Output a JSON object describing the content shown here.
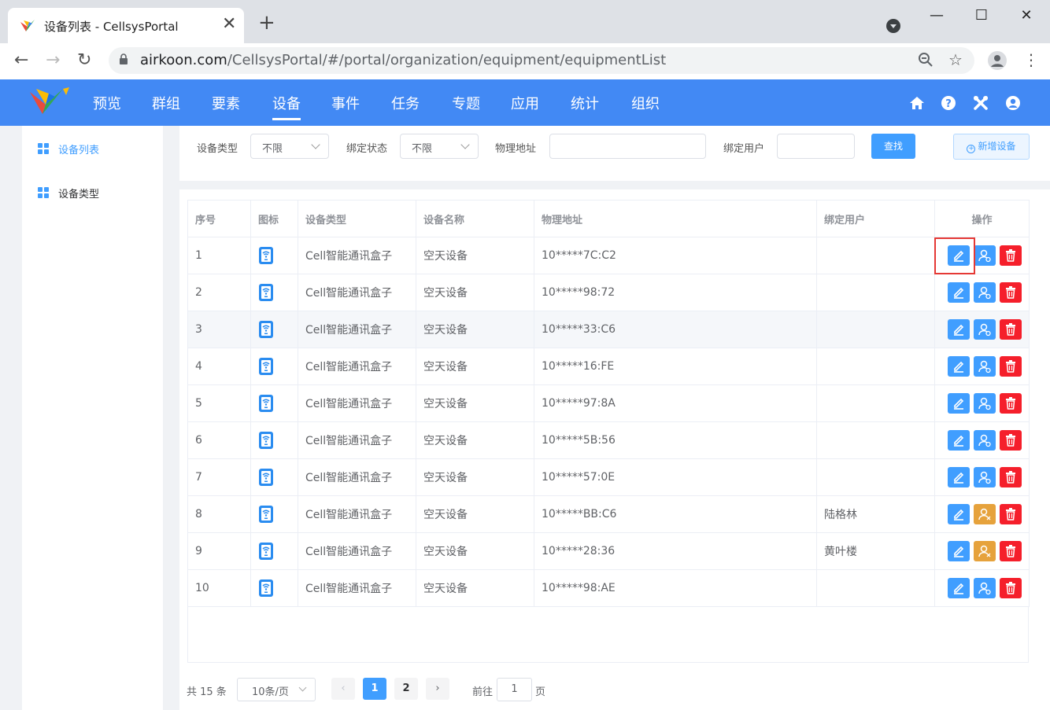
{
  "browser": {
    "tab_title": "设备列表 - CellsysPortal",
    "url_host": "airkoon.com",
    "url_path": "/CellsysPortal/#/portal/organization/equipment/equipmentList"
  },
  "app": {
    "menu": [
      "预览",
      "群组",
      "要素",
      "设备",
      "事件",
      "任务",
      "专题",
      "应用",
      "统计",
      "组织"
    ],
    "active_menu": "设备",
    "brand_color": "#4289f4"
  },
  "sidebar": {
    "items": [
      {
        "label": "设备列表",
        "active": true
      },
      {
        "label": "设备类型",
        "active": false
      }
    ]
  },
  "filters": {
    "type_label": "设备类型",
    "type_value": "不限",
    "bind_label": "绑定状态",
    "bind_value": "不限",
    "mac_label": "物理地址",
    "mac_value": "",
    "user_label": "绑定用户",
    "user_value": "",
    "search_label": "查找",
    "add_label": "新增设备"
  },
  "table": {
    "headers": [
      "序号",
      "图标",
      "设备类型",
      "设备名称",
      "物理地址",
      "绑定用户",
      "操作"
    ],
    "rows": [
      {
        "no": "1",
        "type": "Cell智能通讯盒子",
        "name": "空天设备",
        "mac": "10*****7C:C2",
        "user": "",
        "bound": false
      },
      {
        "no": "2",
        "type": "Cell智能通讯盒子",
        "name": "空天设备",
        "mac": "10*****98:72",
        "user": "",
        "bound": false
      },
      {
        "no": "3",
        "type": "Cell智能通讯盒子",
        "name": "空天设备",
        "mac": "10*****33:C6",
        "user": "",
        "bound": false
      },
      {
        "no": "4",
        "type": "Cell智能通讯盒子",
        "name": "空天设备",
        "mac": "10*****16:FE",
        "user": "",
        "bound": false
      },
      {
        "no": "5",
        "type": "Cell智能通讯盒子",
        "name": "空天设备",
        "mac": "10*****97:8A",
        "user": "",
        "bound": false
      },
      {
        "no": "6",
        "type": "Cell智能通讯盒子",
        "name": "空天设备",
        "mac": "10*****5B:56",
        "user": "",
        "bound": false
      },
      {
        "no": "7",
        "type": "Cell智能通讯盒子",
        "name": "空天设备",
        "mac": "10*****57:0E",
        "user": "",
        "bound": false
      },
      {
        "no": "8",
        "type": "Cell智能通讯盒子",
        "name": "空天设备",
        "mac": "10*****BB:C6",
        "user": "陆格林",
        "bound": true
      },
      {
        "no": "9",
        "type": "Cell智能通讯盒子",
        "name": "空天设备",
        "mac": "10*****28:36",
        "user": "黄叶楼",
        "bound": true
      },
      {
        "no": "10",
        "type": "Cell智能通讯盒子",
        "name": "空天设备",
        "mac": "10*****98:AE",
        "user": "",
        "bound": false
      }
    ]
  },
  "pagination": {
    "total_text": "共 15 条",
    "page_size": "10条/页",
    "pages": [
      "1",
      "2"
    ],
    "current": "1",
    "goto_prefix": "前往",
    "goto_value": "1",
    "goto_suffix": "页"
  }
}
